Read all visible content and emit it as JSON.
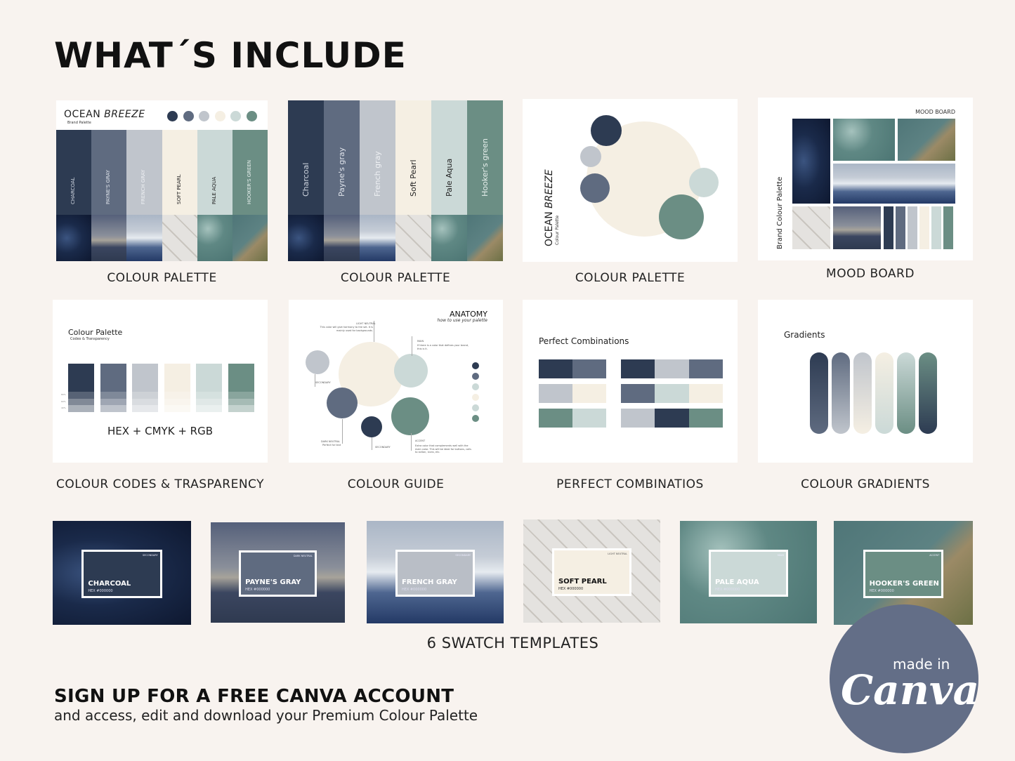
{
  "title": "WHAT´S INCLUDE",
  "colors": {
    "background": "#f8f3ef",
    "charcoal": "#2d3b52",
    "paynes_gray": "#5f6b80",
    "french_gray": "#c0c5cc",
    "soft_pearl": "#f5efe3",
    "pale_aqua": "#cbd9d7",
    "hookers_green": "#6b8e84",
    "canva_badge": "#636e87"
  },
  "palette": [
    {
      "upper": "CHARCOAL",
      "mixed": "Charcoal",
      "hex": "#2d3b52",
      "photo": "night",
      "text": "#cfd5df"
    },
    {
      "upper": "PAYNE'S GRAY",
      "mixed": "Payne's gray",
      "hex": "#5f6b80",
      "photo": "sky",
      "text": "#dfe3ea"
    },
    {
      "upper": "FRENCH GRAY",
      "mixed": "French gray",
      "hex": "#c0c5cc",
      "photo": "mount",
      "text": "#eef0f3"
    },
    {
      "upper": "SOFT PEARL",
      "mixed": "Soft Pearl",
      "hex": "#f5efe3",
      "photo": "marble",
      "text": "#222"
    },
    {
      "upper": "PALE AQUA",
      "mixed": "Pale Aqua",
      "hex": "#cbd9d7",
      "photo": "water",
      "text": "#222"
    },
    {
      "upper": "HOOKER'S GREEN",
      "mixed": "Hooker's green",
      "hex": "#6b8e84",
      "photo": "cliff",
      "text": "#e6efec"
    }
  ],
  "card1": {
    "title_a": "OCEAN ",
    "title_b": "BREEZE",
    "subtitle": "Brand Palette",
    "caption": "COLOUR PALETTE"
  },
  "card2": {
    "caption": "COLOUR PALETTE"
  },
  "card3": {
    "title_a": "OCEAN ",
    "title_b": "BREEZE",
    "subtitle": "Colour Palette",
    "caption": "COLOUR PALETTE"
  },
  "card4": {
    "heading": "MOOD BOARD",
    "side": "Brand Colour Palette",
    "caption": "MOOD BOARD"
  },
  "card5": {
    "title": "Colour Palette",
    "subtitle": "Codes & Transparency",
    "tints": [
      "80%",
      "60%",
      "40%"
    ],
    "formats": "HEX + CMYK + RGB",
    "caption": "COLOUR CODES & TRASPARENCY"
  },
  "card6": {
    "title": "ANATOMY",
    "subtitle": "how to use your palette",
    "caption": "COLOUR GUIDE",
    "notes": {
      "light_title": "LIGHT NEUTRAL",
      "light_text": "This color will give harmony to the set. It is mainly used for backgrounds.",
      "main_title": "MAIN",
      "main_text": "If there is a color that defines your brand, this is it.",
      "secondary1": "SECONDARY",
      "dark_title": "DARK NEUTRAL",
      "dark_text": "Perfect for text",
      "secondary2": "SECONDARY",
      "accent_title": "ACCENT",
      "accent_text": "Extra color that complements well with the main color. This will be ideal for buttons, calls to action, icons, etc."
    }
  },
  "card7": {
    "title": "Perfect Combinations",
    "caption": "PERFECT COMBINATIOS"
  },
  "card8": {
    "title": "Gradients",
    "caption": "COLOUR GRADIENTS"
  },
  "templates": [
    {
      "name": "CHARCOAL",
      "hex": "HEX #000000",
      "role": "SECONDARY",
      "photo": "night",
      "color": "#2d3b52",
      "dark": false
    },
    {
      "name": "PAYNE'S GRAY",
      "hex": "HEX #000000",
      "role": "DARK NEUTRAL",
      "photo": "sky",
      "color": "#5f6b80",
      "dark": false
    },
    {
      "name": "FRENCH GRAY",
      "hex": "HEX #000000",
      "role": "SECONDARY",
      "photo": "mount",
      "color": "#b9bec6",
      "dark": false
    },
    {
      "name": "SOFT PEARL",
      "hex": "HEX #000000",
      "role": "LIGHT NEUTRAL",
      "photo": "marble",
      "color": "#f5efe3",
      "dark": true
    },
    {
      "name": "PALE AQUA",
      "hex": "HEX #000000",
      "role": "MAIN",
      "photo": "water",
      "color": "#cbd9d7",
      "dark": false
    },
    {
      "name": "HOOKER'S GREEN",
      "hex": "HEX #000000",
      "role": "ACCENT",
      "photo": "cliff",
      "color": "#6b8e84",
      "dark": false
    }
  ],
  "templates_caption": "6 SWATCH TEMPLATES",
  "cta": {
    "headline": "SIGN UP FOR A FREE CANVA ACCOUNT",
    "subline": "and access, edit and download your Premium Colour Palette"
  },
  "badge": {
    "made_in": "made in",
    "brand": "Canva"
  }
}
